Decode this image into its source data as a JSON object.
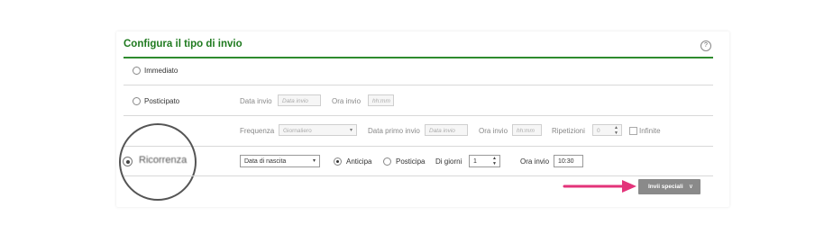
{
  "section": {
    "title": "Configura il tipo di invio",
    "help_icon": "?"
  },
  "immediato": {
    "label": "Immediato"
  },
  "posticipato": {
    "label": "Posticipato",
    "date_label": "Data invio",
    "date_placeholder": "Data invio",
    "time_label": "Ora invio",
    "time_placeholder": "hh:mm"
  },
  "ricorrenza_config": {
    "frequency_label": "Frequenza",
    "frequency_value": "Giornaliero",
    "first_date_label": "Data primo invio",
    "first_date_placeholder": "Data invio",
    "time_label": "Ora invio",
    "time_placeholder": "hh:mm",
    "repetitions_label": "Ripetizioni",
    "repetitions_value": "0",
    "infinite_label": "Infinite"
  },
  "ricorrenza": {
    "label": "Ricorrenza",
    "date_field_value": "Data di nascita",
    "anticipa_label": "Anticipa",
    "posticipa_label": "Posticipa",
    "days_label": "Di giorni",
    "days_value": "1",
    "time_label": "Ora invio",
    "time_value": "10:30"
  },
  "special_button": {
    "label": "Invii speciali",
    "chevron": "∨"
  },
  "colors": {
    "accent": "#2e8b2e",
    "arrow": "#e3337a",
    "button": "#8a8a8a"
  }
}
